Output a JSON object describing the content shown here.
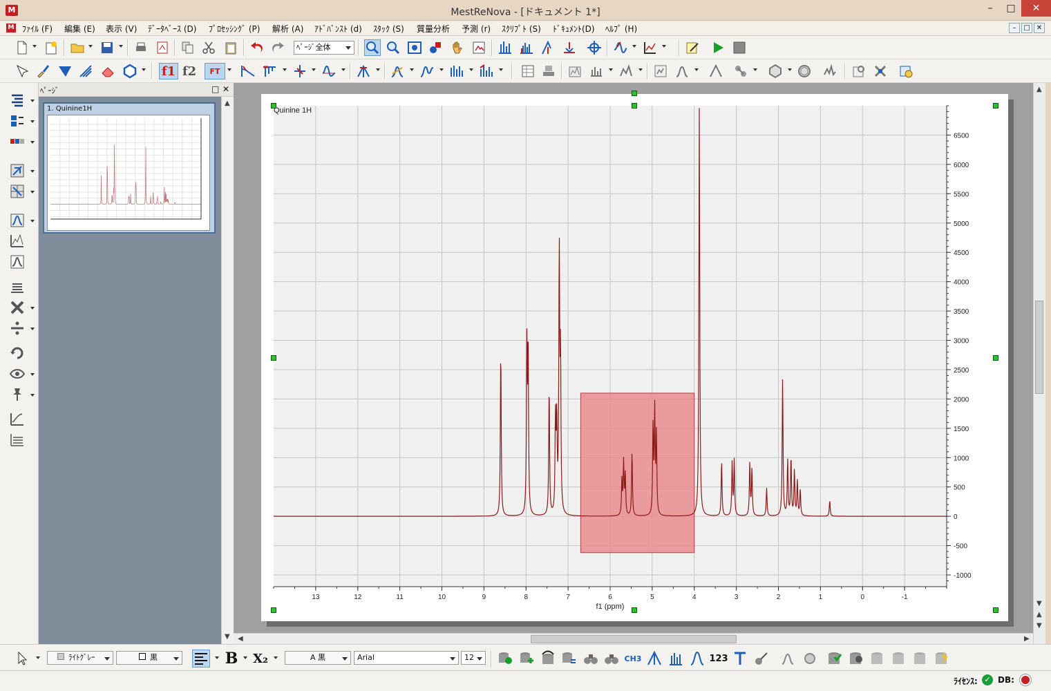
{
  "window": {
    "title": "MestReNova - [ドキュメント 1*]",
    "app_icon": "M",
    "minimize": "–",
    "maximize": "□",
    "close": "✕"
  },
  "menu": [
    "ﾌｧｲﾙ (F)",
    "編集 (E)",
    "表示 (V)",
    "ﾃﾞｰﾀﾍﾞｰｽ (D)",
    "ﾌﾟﾛｾｯｼﾝｸﾞ (P)",
    "解析 (A)",
    "ｱﾄﾞﾊﾞﾝｽﾄ (d)",
    "ｽﾀｯｸ (S)",
    "質量分析",
    "予測 (r)",
    "ｽｸﾘﾌﾟﾄ (S)",
    "ﾄﾞｷｭﾒﾝﾄ(D)",
    "ﾍﾙﾌﾟ (H)"
  ],
  "toolbar": {
    "zoom_value": "ﾍﾟｰｼﾞ全体",
    "f1": "f1",
    "f2": "f2",
    "ft": "FT"
  },
  "pages_panel": {
    "title": "ﾍﾟｰｼﾞ",
    "thumb_label": "1. Quinine1H"
  },
  "spectrum": {
    "label": "Quinine 1H",
    "xlabel": "f1 (ppm)",
    "x_ticks": [
      "13",
      "12",
      "11",
      "10",
      "9",
      "8",
      "7",
      "6",
      "5",
      "4",
      "3",
      "2",
      "1",
      "0",
      "-1"
    ],
    "y_ticks": [
      "6500",
      "6000",
      "5500",
      "5000",
      "4500",
      "4000",
      "3500",
      "3000",
      "2500",
      "2000",
      "1500",
      "1000",
      "500",
      "0",
      "-500",
      "-1000"
    ],
    "line_color": "#8b1a1a",
    "selection_color": "#e8868a"
  },
  "chart_data": {
    "type": "line",
    "title": "Quinine 1H",
    "xlabel": "f1 (ppm)",
    "ylabel": "",
    "xlim": [
      14,
      -2
    ],
    "ylim": [
      -1200,
      7000
    ],
    "x_ticks": [
      13,
      12,
      11,
      10,
      9,
      8,
      7,
      6,
      5,
      4,
      3,
      2,
      1,
      0,
      -1
    ],
    "y_ticks": [
      6500,
      6000,
      5500,
      5000,
      4500,
      4000,
      3500,
      3000,
      2500,
      2000,
      1500,
      1000,
      500,
      0,
      -500,
      -1000
    ],
    "grid": true,
    "peaks": [
      {
        "ppm": 8.6,
        "intensity": 2850
      },
      {
        "ppm": 7.98,
        "intensity": 2800
      },
      {
        "ppm": 7.95,
        "intensity": 2850
      },
      {
        "ppm": 7.45,
        "intensity": 2200
      },
      {
        "ppm": 7.3,
        "intensity": 1600
      },
      {
        "ppm": 7.27,
        "intensity": 1550
      },
      {
        "ppm": 7.21,
        "intensity": 4450
      },
      {
        "ppm": 7.18,
        "intensity": 2550
      },
      {
        "ppm": 5.72,
        "intensity": 600
      },
      {
        "ppm": 5.68,
        "intensity": 900
      },
      {
        "ppm": 5.64,
        "intensity": 700
      },
      {
        "ppm": 5.48,
        "intensity": 1100
      },
      {
        "ppm": 4.98,
        "intensity": 1500
      },
      {
        "ppm": 4.94,
        "intensity": 1750
      },
      {
        "ppm": 4.9,
        "intensity": 1350
      },
      {
        "ppm": 3.88,
        "intensity": 7000
      },
      {
        "ppm": 3.35,
        "intensity": 950
      },
      {
        "ppm": 3.1,
        "intensity": 900
      },
      {
        "ppm": 3.05,
        "intensity": 950
      },
      {
        "ppm": 2.68,
        "intensity": 900
      },
      {
        "ppm": 2.63,
        "intensity": 800
      },
      {
        "ppm": 2.28,
        "intensity": 480
      },
      {
        "ppm": 1.9,
        "intensity": 2350
      },
      {
        "ppm": 1.78,
        "intensity": 950
      },
      {
        "ppm": 1.7,
        "intensity": 1000
      },
      {
        "ppm": 1.62,
        "intensity": 780
      },
      {
        "ppm": 1.55,
        "intensity": 600
      },
      {
        "ppm": 1.48,
        "intensity": 450
      },
      {
        "ppm": 0.78,
        "intensity": 270
      }
    ],
    "selection": {
      "x_from": 6.7,
      "x_to": 4.0,
      "y_from": -620,
      "y_to": 2100
    }
  },
  "format": {
    "fill": "ﾗｲﾄｸﾞﾚｰ",
    "line": "黒",
    "text_color": "A 黒",
    "font": "Arial",
    "size": "12",
    "bold": "B",
    "sub": "X₂",
    "ch3": "CH3",
    "n123": "123"
  },
  "status": {
    "license": "ﾗｲｾﾝｽ:",
    "db": "DB:"
  }
}
